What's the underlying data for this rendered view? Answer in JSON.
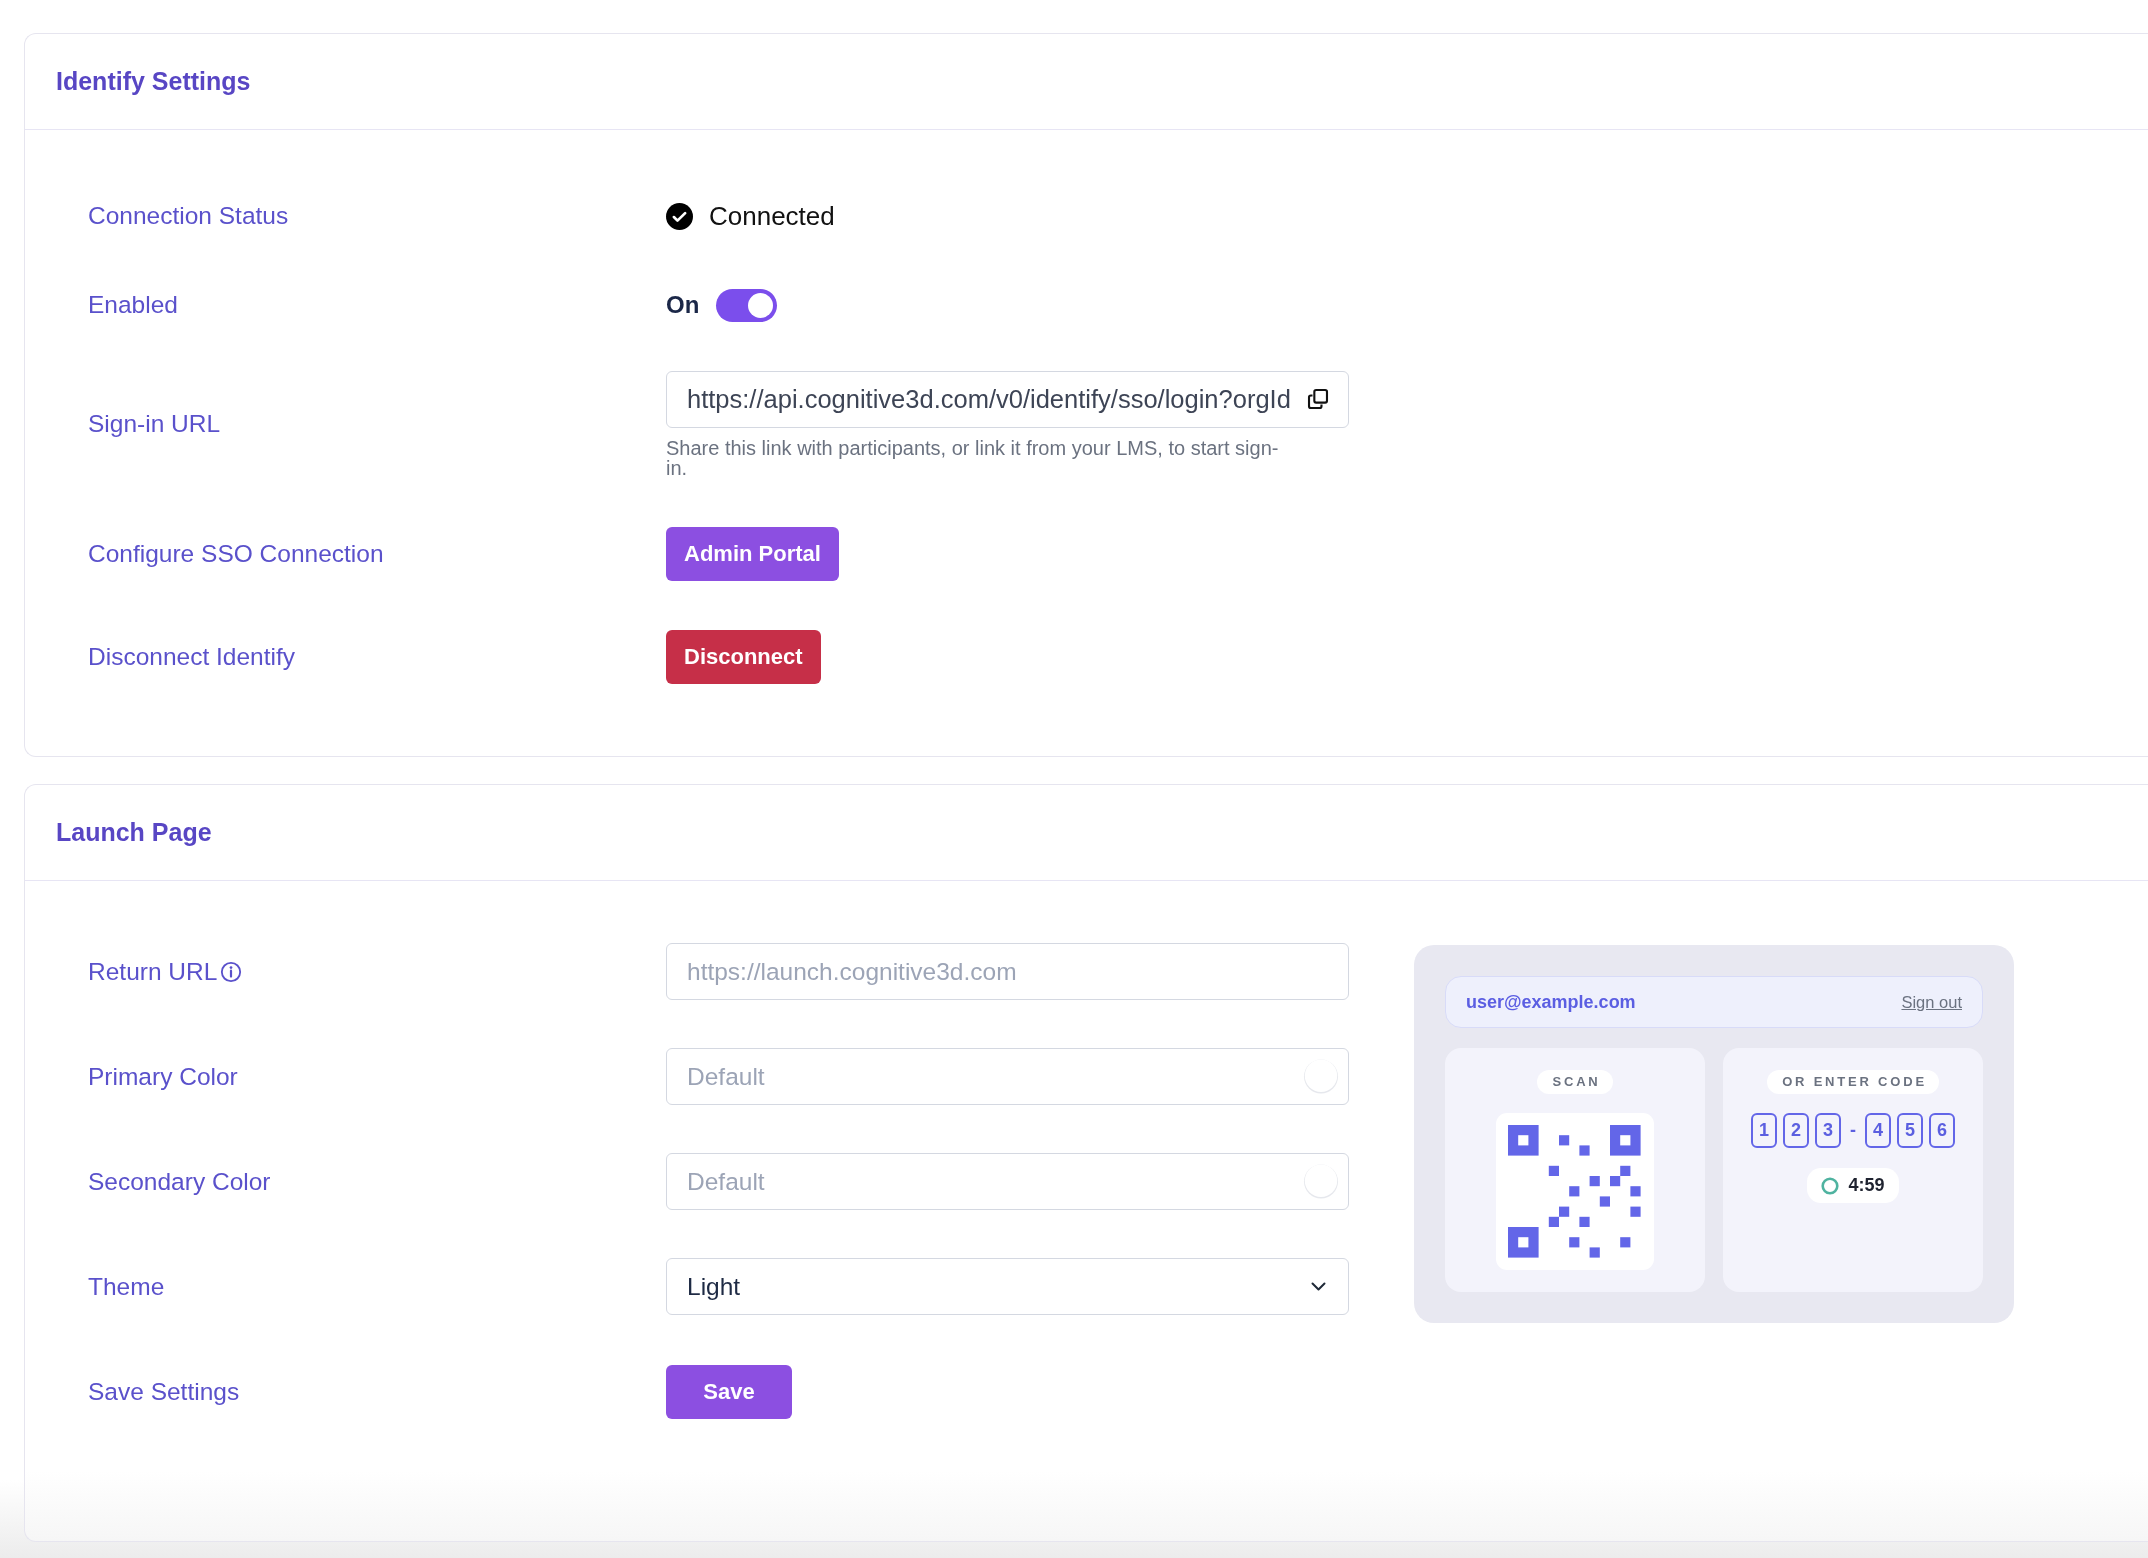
{
  "sections": [
    {
      "title": "Identify Settings",
      "rows": [
        {
          "kind": "status",
          "label": "Connection Status",
          "value": "Connected"
        },
        {
          "kind": "toggle",
          "label": "Enabled",
          "state_label": "On",
          "on": true
        },
        {
          "kind": "url",
          "label": "Sign-in URL",
          "value": "https://api.cognitive3d.com/v0/identify/sso/login?orgId",
          "hint": "Share this link with participants, or link it from your LMS, to start sign-in."
        },
        {
          "kind": "button",
          "label": "Configure SSO Connection",
          "button": "Admin Portal"
        },
        {
          "kind": "danger",
          "label": "Disconnect Identify",
          "button": "Disconnect"
        }
      ]
    },
    {
      "title": "Launch Page",
      "rows": [
        {
          "kind": "text",
          "label": "Return URL",
          "info": true,
          "placeholder": "https://launch.cognitive3d.com"
        },
        {
          "kind": "color",
          "label": "Primary Color",
          "placeholder": "Default"
        },
        {
          "kind": "color",
          "label": "Secondary Color",
          "placeholder": "Default"
        },
        {
          "kind": "select",
          "label": "Theme",
          "value": "Light"
        },
        {
          "kind": "button",
          "label": "Save Settings",
          "button": "Save"
        }
      ],
      "preview": {
        "email": "user@example.com",
        "sign_out": "Sign out",
        "scan_heading": "SCAN",
        "code_heading": "OR ENTER CODE",
        "code_groups": [
          [
            "1",
            "2",
            "3"
          ],
          [
            "4",
            "5",
            "6"
          ]
        ],
        "code_separator": "-",
        "timer": "4:59"
      }
    }
  ]
}
